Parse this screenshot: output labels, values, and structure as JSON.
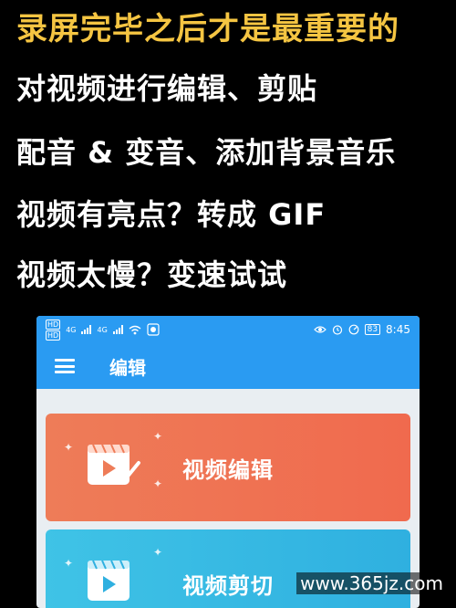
{
  "headline": "录屏完毕之后才是最重要的",
  "lines": [
    "对视频进行编辑、剪贴",
    "配音 & 变音、添加背景音乐",
    "视频有亮点？转成 GIF",
    "视频太慢？变速试试"
  ],
  "phone": {
    "status": {
      "sim1": "HD",
      "sim2": "HD",
      "sig1": "4G",
      "sig2": "4G",
      "battery": "83",
      "time": "8:45"
    },
    "appbar_title": "编辑",
    "cards": [
      {
        "label": "视频编辑",
        "color": "#ee7c58"
      },
      {
        "label": "视频剪切",
        "color": "#3fc3e6"
      }
    ]
  },
  "watermark": "www.365jz.com"
}
